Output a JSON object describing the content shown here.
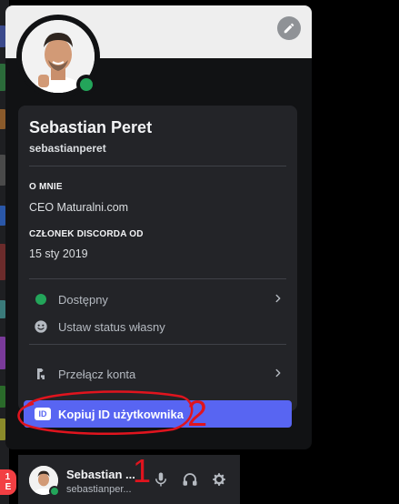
{
  "profile": {
    "display_name": "Sebastian Peret",
    "username": "sebastianperet",
    "about_title": "O MNIE",
    "about_text": "CEO Maturalni.com",
    "member_since_title": "CZŁONEK DISCORDA OD",
    "member_since_text": "15 sty 2019"
  },
  "menu": {
    "status_label": "Dostępny",
    "custom_status_label": "Ustaw status własny",
    "switch_accounts_label": "Przełącz konta",
    "copy_id_label": "Kopiuj ID użytkownika",
    "id_badge": "ID"
  },
  "user_panel": {
    "name": "Sebastian ...",
    "username": "sebastianper..."
  },
  "left_badge": "1\nE",
  "annotations": {
    "one": "1",
    "two": "2"
  },
  "colors": {
    "accent": "#5865f2",
    "online": "#23a55a",
    "annotation": "#e0141e"
  }
}
